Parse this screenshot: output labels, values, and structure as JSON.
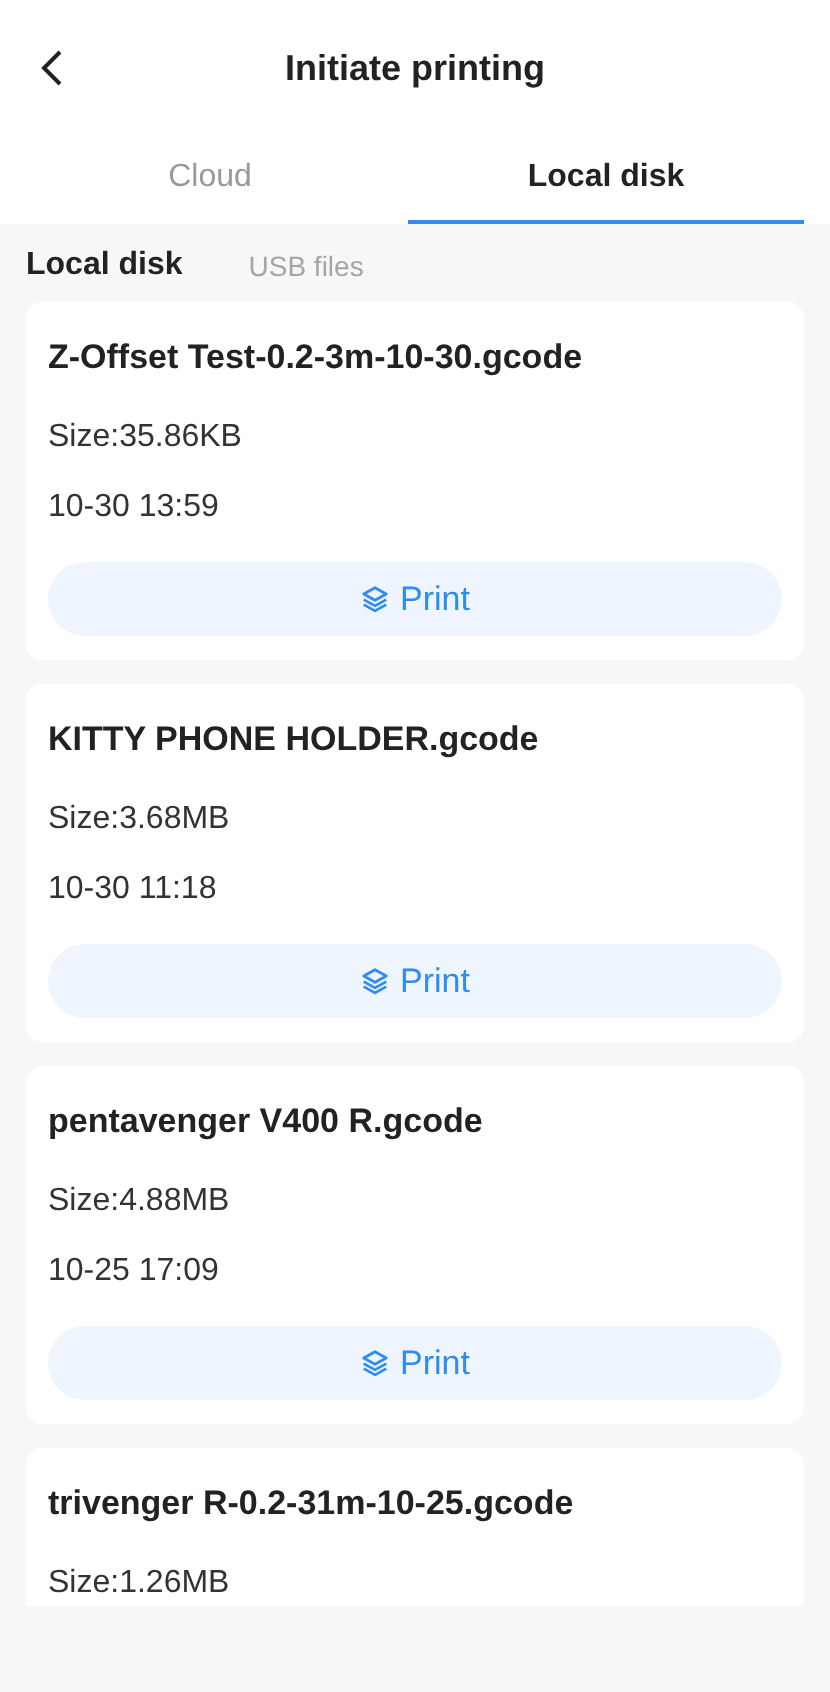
{
  "header": {
    "title": "Initiate printing"
  },
  "tabs": [
    {
      "label": "Cloud",
      "selected": false
    },
    {
      "label": "Local disk",
      "selected": true
    }
  ],
  "sources": [
    {
      "label": "Local disk",
      "selected": true
    },
    {
      "label": "USB files",
      "selected": false
    }
  ],
  "files": [
    {
      "name": "Z-Offset Test-0.2-3m-10-30.gcode",
      "size": "Size:35.86KB",
      "date": "10-30 13:59",
      "action": "Print"
    },
    {
      "name": "KITTY PHONE HOLDER.gcode",
      "size": "Size:3.68MB",
      "date": "10-30 11:18",
      "action": "Print"
    },
    {
      "name": "pentavenger V400 R.gcode",
      "size": "Size:4.88MB",
      "date": "10-25 17:09",
      "action": "Print"
    },
    {
      "name": "trivenger R-0.2-31m-10-25.gcode",
      "size": "Size:1.26MB"
    }
  ]
}
